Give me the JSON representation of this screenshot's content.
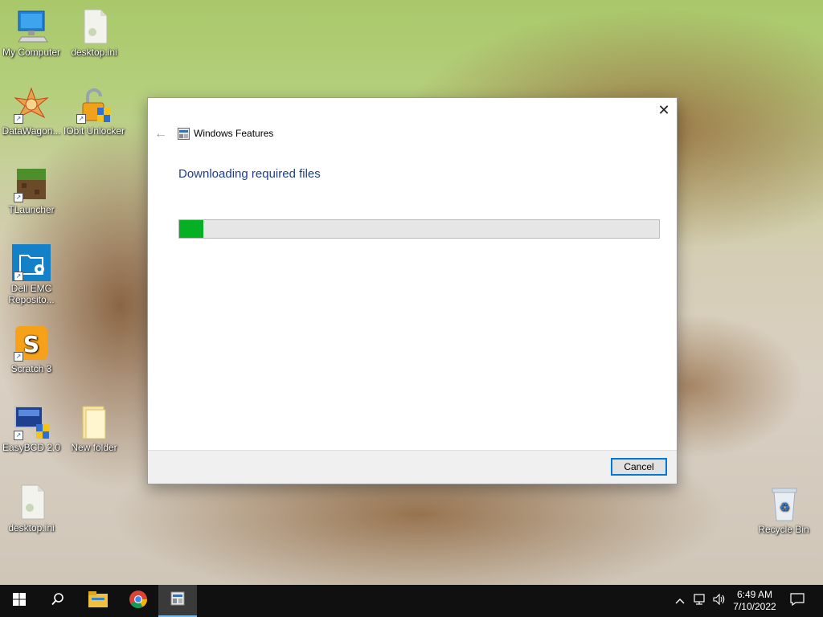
{
  "desktop": {
    "icons": [
      {
        "label": "My Computer",
        "icon": "computer-icon"
      },
      {
        "label": "desktop.ini",
        "icon": "ini-file-icon"
      },
      {
        "label": "DataWagon...",
        "icon": "datawagon-icon"
      },
      {
        "label": "IObit Unlocker",
        "icon": "iobit-unlocker-icon"
      },
      {
        "label": "TLauncher",
        "icon": "tlauncher-icon"
      },
      {
        "label": "Dell EMC Reposito...",
        "icon": "dell-emc-icon"
      },
      {
        "label": "Scratch 3",
        "icon": "scratch-icon"
      },
      {
        "label": "EasyBCD 2.0",
        "icon": "easybcd-icon"
      },
      {
        "label": "New folder",
        "icon": "folder-icon"
      },
      {
        "label": "desktop.ini",
        "icon": "ini-file-icon"
      },
      {
        "label": "Recycle Bin",
        "icon": "recycle-bin-icon"
      }
    ]
  },
  "dialog": {
    "title": "Windows Features",
    "heading": "Downloading required files",
    "progress_fraction": 0.05,
    "progress_color": "#06b025",
    "cancel_label": "Cancel",
    "close_glyph": "✕",
    "back_glyph": "←"
  },
  "taskbar": {
    "items": [
      {
        "name": "start",
        "icon": "windows-logo-icon"
      },
      {
        "name": "search",
        "icon": "search-icon"
      },
      {
        "name": "file-explorer",
        "icon": "folder-icon"
      },
      {
        "name": "chrome",
        "icon": "chrome-icon"
      },
      {
        "name": "windows-features",
        "icon": "windows-features-icon",
        "active": true
      }
    ],
    "clock_time": "6:49 AM",
    "clock_date": "7/10/2022"
  }
}
